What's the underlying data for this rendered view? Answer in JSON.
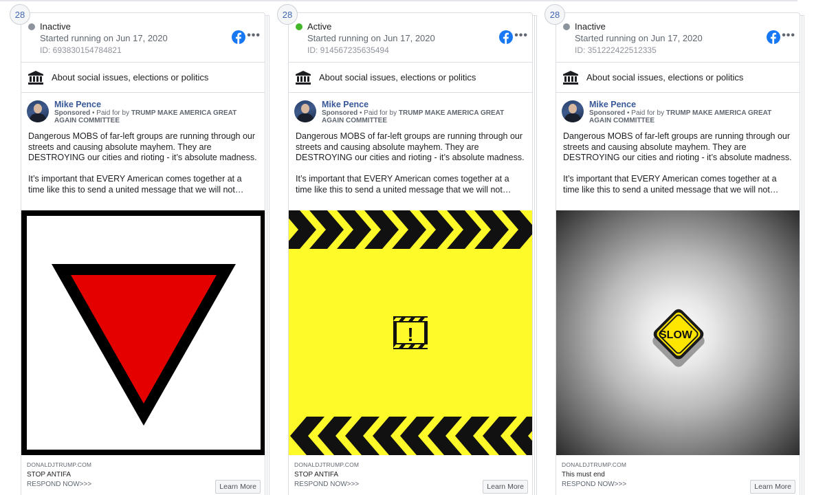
{
  "common": {
    "about_label": "About social issues, elections or politics",
    "page_name": "Mike Pence",
    "sponsored": "Sponsored",
    "paid_for_prefix": " • Paid for by ",
    "paid_for_org": "TRUMP MAKE AMERICA GREAT AGAIN COMMITTEE",
    "ad_text": "Dangerous MOBS of far-left groups are running through our streets and causing absolute mayhem. They are DESTROYING our cities and rioting - it’s absolute madness.\n\nIt’s important that EVERY American comes together at a time like this to send a united message that we will not…",
    "domain": "DONALDJTRUMP.COM",
    "learn_more": "Learn More",
    "description": "RESPOND NOW>>>",
    "more_menu": "•••"
  },
  "colors": {
    "inactive_dot": "#8d949e",
    "active_dot": "#42b72a",
    "facebook_blue": "#1877f2",
    "link_blue": "#385898"
  },
  "cards": [
    {
      "badge": "28",
      "status": "Inactive",
      "status_dot": "gray",
      "started": "Started running on Jun 17, 2020",
      "id": "ID: 693830154784821",
      "headline": "STOP ANTIFA",
      "image": "inverted-red-triangle"
    },
    {
      "badge": "28",
      "status": "Active",
      "status_dot": "green",
      "started": "Started running on Jun 17, 2020",
      "id": "ID: 914567235635494",
      "headline": "STOP ANTIFA",
      "image": "yellow-hazard-warning",
      "image_icon": "!"
    },
    {
      "badge": "28",
      "status": "Inactive",
      "status_dot": "gray",
      "started": "Started running on Jun 17, 2020",
      "id": "ID: 351222422512335",
      "headline": "This must end",
      "image": "slow-road-sign",
      "sign_text": "SLOW"
    }
  ]
}
